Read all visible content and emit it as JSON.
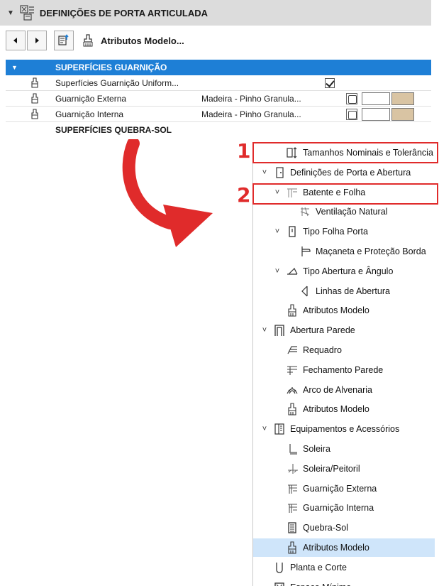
{
  "header": {
    "title": "DEFINIÇÕES DE PORTA ARTICULADA"
  },
  "toolbar": {
    "label": "Atributos Modelo..."
  },
  "table": {
    "section1": "SUPERFÍCIES GUARNIÇÃO",
    "rows": [
      {
        "name": "Superfícies Guarnição Uniform...",
        "value": "",
        "checked": true
      },
      {
        "name": "Guarnição Externa",
        "value": "Madeira - Pinho Granula..."
      },
      {
        "name": "Guarnição Interna",
        "value": "Madeira - Pinho Granula..."
      }
    ],
    "section2": "SUPERFÍCIES QUEBRA-SOL"
  },
  "annotations": {
    "n1": "1",
    "n2": "2",
    "color": "#e02b2b"
  },
  "tree": [
    {
      "label": "Tamanhos Nominais e Tolerância",
      "icon": "nominal-size-icon",
      "level": 1,
      "chevron": ""
    },
    {
      "label": "Definições de Porta e Abertura",
      "icon": "door-settings-icon",
      "level": 0,
      "chevron": "expanded"
    },
    {
      "label": "Batente e Folha",
      "icon": "frame-leaf-icon",
      "level": 1,
      "chevron": "expanded"
    },
    {
      "label": "Ventilação Natural",
      "icon": "ventilation-icon",
      "level": 2,
      "chevron": ""
    },
    {
      "label": "Tipo Folha Porta",
      "icon": "door-leaf-icon",
      "level": 1,
      "chevron": "expanded"
    },
    {
      "label": "Maçaneta e Proteção Borda",
      "icon": "handle-icon",
      "level": 2,
      "chevron": ""
    },
    {
      "label": "Tipo Abertura e Ângulo",
      "icon": "opening-angle-icon",
      "level": 1,
      "chevron": "expanded"
    },
    {
      "label": "Linhas de Abertura",
      "icon": "opening-lines-icon",
      "level": 2,
      "chevron": ""
    },
    {
      "label": "Atributos Modelo",
      "icon": "brush-icon",
      "level": 1,
      "chevron": ""
    },
    {
      "label": "Abertura Parede",
      "icon": "wall-opening-icon",
      "level": 0,
      "chevron": "expanded"
    },
    {
      "label": "Requadro",
      "icon": "reveal-icon",
      "level": 1,
      "chevron": ""
    },
    {
      "label": "Fechamento Parede",
      "icon": "wall-closure-icon",
      "level": 1,
      "chevron": ""
    },
    {
      "label": "Arco de Alvenaria",
      "icon": "arch-icon",
      "level": 1,
      "chevron": ""
    },
    {
      "label": "Atributos Modelo",
      "icon": "brush-icon",
      "level": 1,
      "chevron": ""
    },
    {
      "label": "Equipamentos e Acessórios",
      "icon": "equipment-icon",
      "level": 0,
      "chevron": "expanded"
    },
    {
      "label": "Soleira",
      "icon": "threshold-icon",
      "level": 1,
      "chevron": ""
    },
    {
      "label": "Soleira/Peitoril",
      "icon": "sill-icon",
      "level": 1,
      "chevron": ""
    },
    {
      "label": "Guarnição Externa",
      "icon": "casing-icon",
      "level": 1,
      "chevron": ""
    },
    {
      "label": "Guarnição Interna",
      "icon": "casing-icon",
      "level": 1,
      "chevron": ""
    },
    {
      "label": "Quebra-Sol",
      "icon": "sunshade-icon",
      "level": 1,
      "chevron": ""
    },
    {
      "label": "Atributos Modelo",
      "icon": "brush-icon",
      "level": 1,
      "chevron": "",
      "selected": true
    },
    {
      "label": "Planta e Corte",
      "icon": "plan-section-icon",
      "level": 0,
      "chevron": ""
    },
    {
      "label": "Espaço Mínimo",
      "icon": "clearance-icon",
      "level": 0,
      "chevron": ""
    }
  ]
}
